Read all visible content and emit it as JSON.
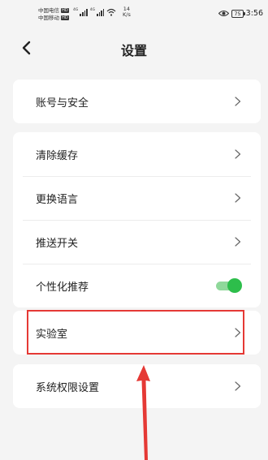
{
  "status_bar": {
    "carrier_1": "中国电信",
    "carrier_2": "中国移动",
    "hd_badge": "HD",
    "signal_tag": "4G",
    "net_speed_value": "14",
    "net_speed_unit": "K/s",
    "battery": "75",
    "time": "3:56"
  },
  "header": {
    "title": "设置"
  },
  "groups": {
    "account": {
      "label": "账号与安全"
    },
    "general": {
      "clear_cache": "清除缓存",
      "change_language": "更换语言",
      "push_switch": "推送开关",
      "personalized": "个性化推荐",
      "personalized_enabled": true
    },
    "lab": {
      "label": "实验室"
    },
    "permissions": {
      "label": "系统权限设置"
    }
  },
  "colors": {
    "toggle_on": "#2dbe4b",
    "highlight": "#e53935",
    "arrow": "#e53935"
  }
}
